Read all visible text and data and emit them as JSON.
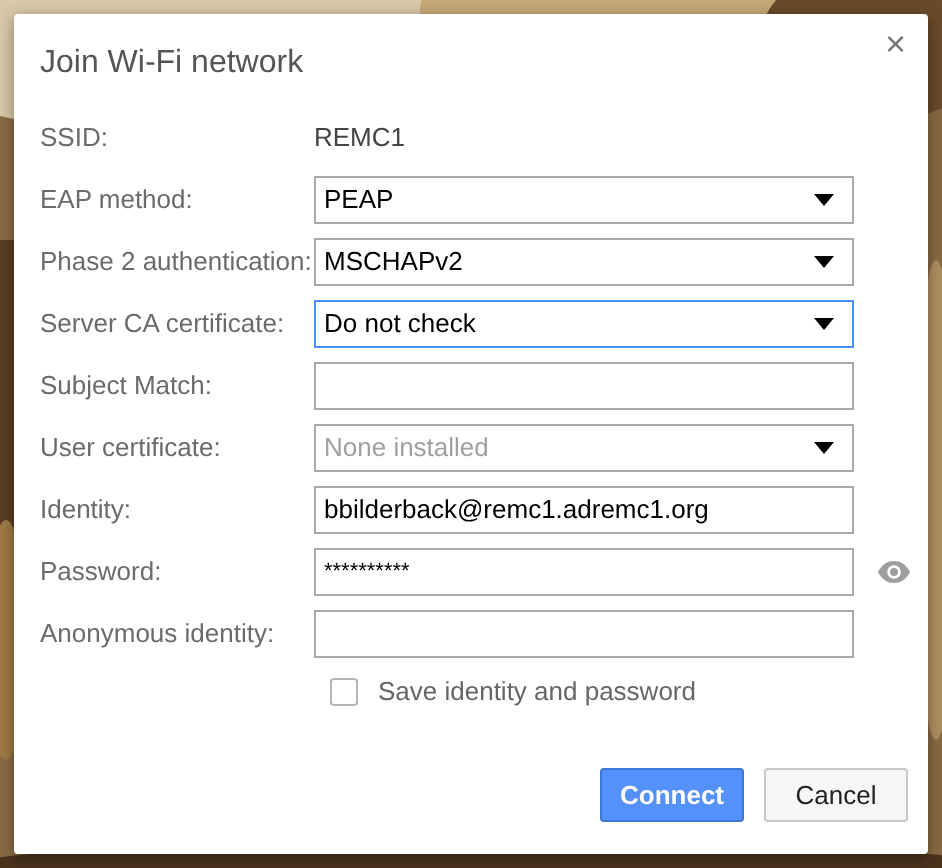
{
  "dialog": {
    "title": "Join Wi-Fi network",
    "close": "×"
  },
  "fields": [
    {
      "label": "SSID:",
      "kind": "text",
      "value": "REMC1"
    },
    {
      "label": "EAP method:",
      "kind": "select",
      "value": "PEAP",
      "focused": false,
      "disabled": false
    },
    {
      "label": "Phase 2 authentication:",
      "kind": "select",
      "value": "MSCHAPv2",
      "focused": false,
      "disabled": false
    },
    {
      "label": "Server CA certificate:",
      "kind": "select",
      "value": "Do not check",
      "focused": true,
      "disabled": false
    },
    {
      "label": "Subject Match:",
      "kind": "input",
      "focused": false
    },
    {
      "label": "User certificate:",
      "kind": "select",
      "value": "None installed",
      "focused": false,
      "disabled": true
    },
    {
      "label": "Identity:",
      "kind": "input",
      "value": "bbilderback@remc1.adremc1.org",
      "focused": false
    },
    {
      "label": "Password:",
      "kind": "password",
      "value": "**********",
      "focused": false
    },
    {
      "label": "Anonymous identity:",
      "kind": "input",
      "focused": false
    }
  ],
  "save_checkbox": {
    "label": "Save identity and password",
    "checked": false
  },
  "buttons": [
    {
      "label": "Connect",
      "primary": true
    },
    {
      "label": "Cancel",
      "primary": false
    }
  ]
}
